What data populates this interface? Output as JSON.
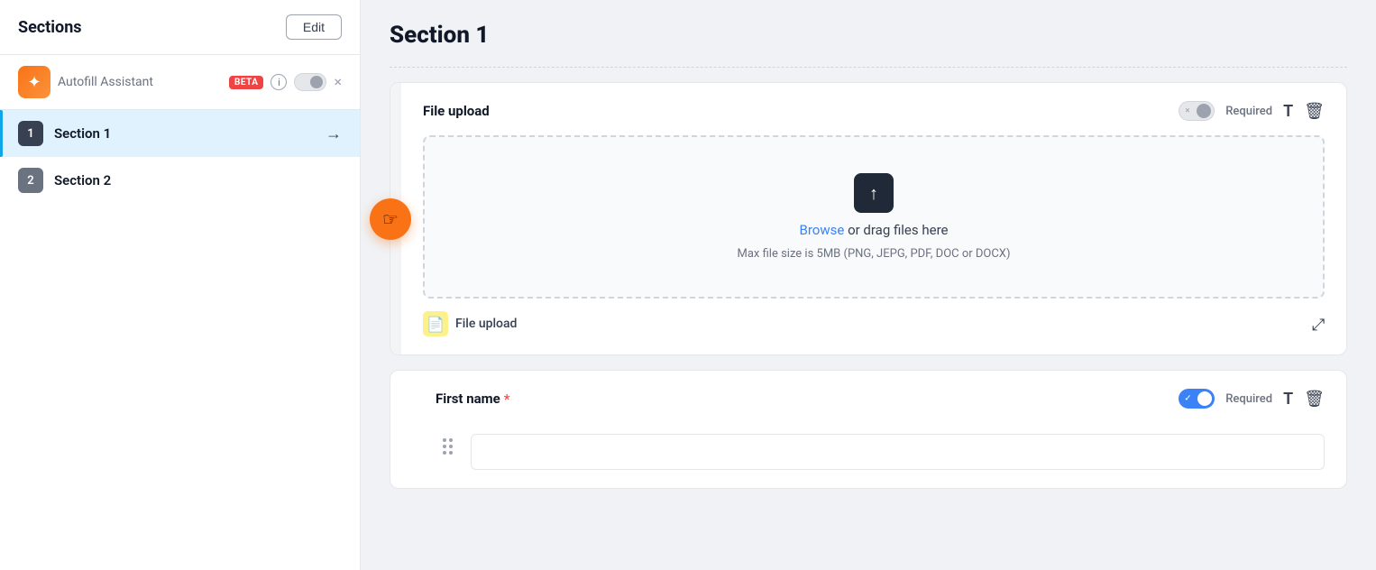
{
  "sidebar": {
    "title": "Sections",
    "edit_button": "Edit",
    "autofill": {
      "label": "Autofill Assistant",
      "beta_badge": "BETA",
      "icon": "✦"
    },
    "sections": [
      {
        "id": 1,
        "name": "Section 1",
        "active": true
      },
      {
        "id": 2,
        "name": "Section 2",
        "active": false
      }
    ]
  },
  "main": {
    "page_title": "Section 1",
    "cards": [
      {
        "id": "file-upload-card",
        "label": "File upload",
        "required_text": "Required",
        "required_enabled": false,
        "upload_area": {
          "browse_text": "Browse",
          "drag_text": "or drag files here",
          "hint": "Max file size is 5MB (PNG, JEPG, PDF, DOC or DOCX)"
        },
        "footer_label": "File upload"
      },
      {
        "id": "first-name-card",
        "label": "First name",
        "required_text": "Required",
        "required_enabled": true,
        "has_required_star": true
      }
    ]
  },
  "icons": {
    "arrow_right": "→",
    "close": "×",
    "upload": "↑",
    "file": "📄",
    "trash": "🗑",
    "text": "T",
    "resize": "⤢",
    "hand": "☞",
    "drag": "⠿"
  }
}
